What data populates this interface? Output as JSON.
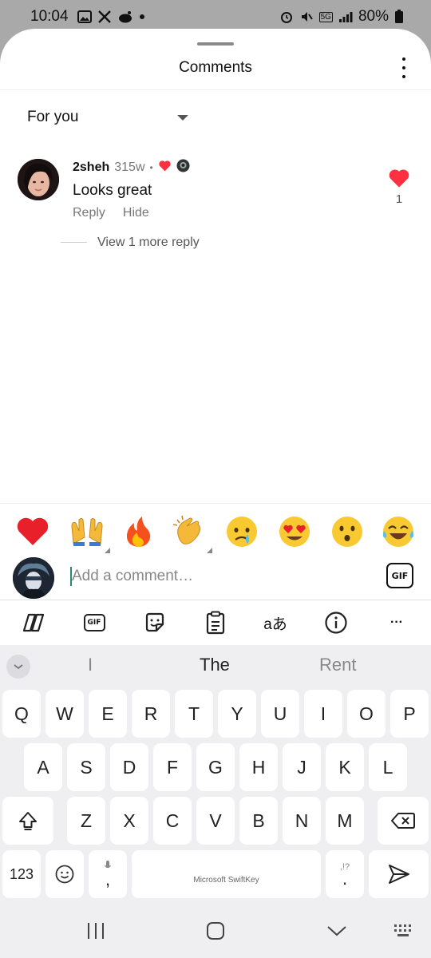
{
  "status_bar": {
    "time": "10:04",
    "battery": "80%",
    "network": "5G"
  },
  "sheet": {
    "title": "Comments"
  },
  "sort": {
    "label": "For you"
  },
  "comment": {
    "username": "2sheh",
    "time": "315w",
    "separator": "•",
    "text": "Looks great",
    "reply_label": "Reply",
    "hide_label": "Hide",
    "like_count": "1",
    "view_more_label": "View 1 more reply"
  },
  "reactions": [
    {
      "name": "red-heart"
    },
    {
      "name": "raising-hands"
    },
    {
      "name": "fire"
    },
    {
      "name": "clapping-hands"
    },
    {
      "name": "crying-face"
    },
    {
      "name": "heart-eyes"
    },
    {
      "name": "surprised-face"
    },
    {
      "name": "tears-of-joy"
    }
  ],
  "comment_input": {
    "placeholder": "Add a comment…",
    "gif_label": "GIF"
  },
  "keyboard": {
    "toolbar_gif_label": "GIF",
    "toolbar_translate_label": "aあ",
    "toolbar_more_label": "···",
    "suggestions": [
      "I",
      "The",
      "Rent"
    ],
    "rows": [
      [
        "Q",
        "W",
        "E",
        "R",
        "T",
        "Y",
        "U",
        "I",
        "O",
        "P"
      ],
      [
        "A",
        "S",
        "D",
        "F",
        "G",
        "H",
        "J",
        "K",
        "L"
      ],
      [
        "Z",
        "X",
        "C",
        "V",
        "B",
        "N",
        "M"
      ]
    ],
    "numbers_label": "123",
    "comma_label": ",",
    "period_label": ".",
    "punct_hint": ",!?",
    "space_label": "Microsoft SwiftKey"
  },
  "colors": {
    "accent_red": "#ff3040",
    "cursor_green": "#2a8a6e"
  }
}
